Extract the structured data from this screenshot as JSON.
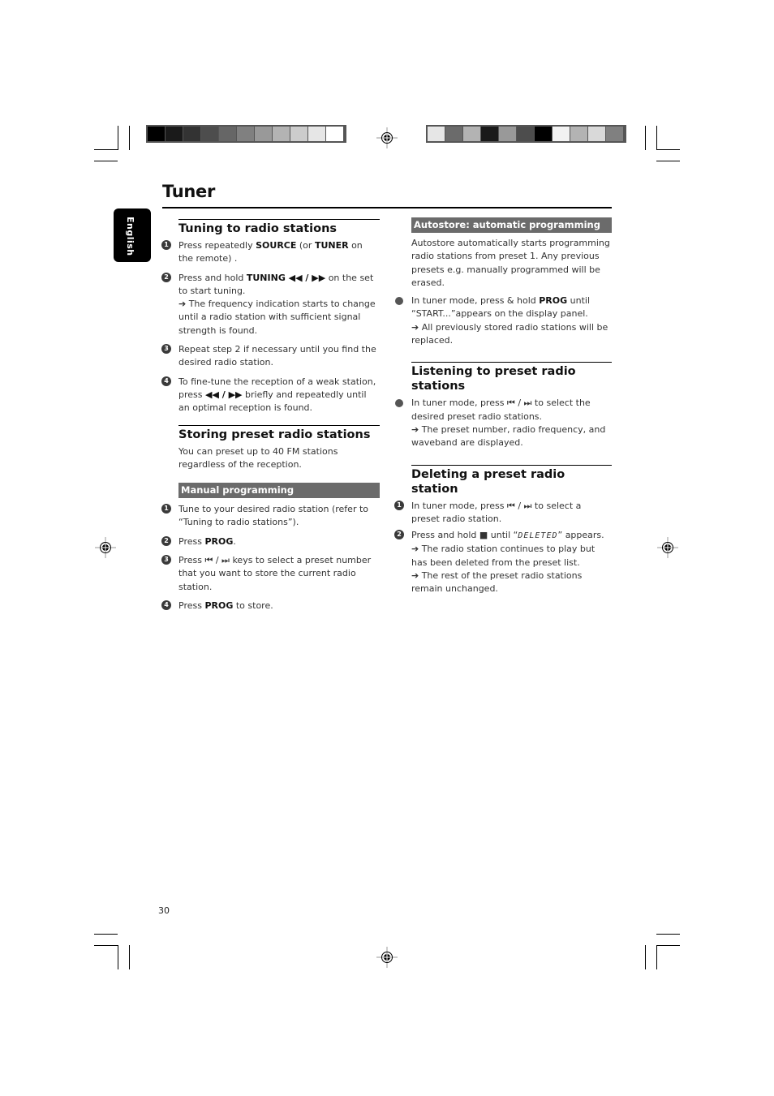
{
  "header": {
    "strip_left_colors": [
      "#000000",
      "#1a1a1a",
      "#333333",
      "#4d4d4d",
      "#666666",
      "#808080",
      "#999999",
      "#b3b3b3",
      "#cccccc",
      "#e6e6e6",
      "#ffffff"
    ],
    "strip_right_colors": [
      "#e6e6e6",
      "#6b6b6b",
      "#b3b3b3",
      "#1a1a1a",
      "#999999",
      "#4d4d4d",
      "#000000",
      "#f2f2f2",
      "#b3b3b3",
      "#d9d9d9",
      "#808080"
    ]
  },
  "page": {
    "title": "Tuner",
    "language_tab": "English",
    "page_number": "30"
  },
  "left": {
    "tuning": {
      "heading": "Tuning to radio stations",
      "steps": [
        {
          "num": "1",
          "parts": [
            [
              "t",
              "Press repeatedly "
            ],
            [
              "b",
              "SOURCE"
            ],
            [
              "t",
              " (or "
            ],
            [
              "b",
              "TUNER"
            ],
            [
              "t",
              " on the remote) ."
            ]
          ]
        },
        {
          "num": "2",
          "parts": [
            [
              "t",
              "Press and hold "
            ],
            [
              "b",
              "TUNING ◀◀ / ▶▶"
            ],
            [
              "t",
              " on the set to start tuning."
            ],
            [
              "br",
              ""
            ],
            [
              "t",
              "➔ The frequency indication starts to change until a radio station with sufficient signal strength is found."
            ]
          ]
        },
        {
          "num": "3",
          "parts": [
            [
              "t",
              "Repeat step 2 if necessary until you find the desired radio station."
            ]
          ]
        },
        {
          "num": "4",
          "parts": [
            [
              "t",
              "To fine-tune the reception of a weak station, press "
            ],
            [
              "b",
              "◀◀ / ▶▶"
            ],
            [
              "t",
              " briefly and repeatedly until an optimal reception is found."
            ]
          ]
        }
      ]
    },
    "storing": {
      "heading": "Storing preset radio stations",
      "intro": "You can preset up to 40 FM stations regardless of the reception.",
      "subheading": "Manual programming",
      "steps": [
        {
          "num": "1",
          "parts": [
            [
              "t",
              "Tune to your desired radio station (refer to “Tuning to radio stations”)."
            ]
          ]
        },
        {
          "num": "2",
          "parts": [
            [
              "t",
              "Press "
            ],
            [
              "b",
              "PROG"
            ],
            [
              "t",
              "."
            ]
          ]
        },
        {
          "num": "3",
          "parts": [
            [
              "t",
              "Press ⏮ / ⏭ keys to select a preset number that you want to store the current radio station."
            ]
          ]
        },
        {
          "num": "4",
          "parts": [
            [
              "t",
              "Press "
            ],
            [
              "b",
              "PROG"
            ],
            [
              "t",
              " to store."
            ]
          ]
        }
      ]
    }
  },
  "right": {
    "autostore": {
      "subheading": "Autostore: automatic programming",
      "intro": "Autostore automatically starts programming radio stations from preset 1. Any previous presets e.g. manually programmed will be erased.",
      "bullets": [
        {
          "parts": [
            [
              "t",
              "In tuner mode, press & hold "
            ],
            [
              "b",
              "PROG"
            ],
            [
              "t",
              " until “START...”appears on the display panel."
            ],
            [
              "br",
              ""
            ],
            [
              "t",
              "➔ All previously stored radio stations will be replaced."
            ]
          ]
        }
      ]
    },
    "listening": {
      "heading": "Listening to preset radio stations",
      "bullets": [
        {
          "parts": [
            [
              "t",
              "In tuner mode, press ⏮ / ⏭ to select the desired preset radio stations."
            ],
            [
              "br",
              ""
            ],
            [
              "t",
              "➔ The preset number, radio frequency, and waveband are displayed."
            ]
          ]
        }
      ]
    },
    "deleting": {
      "heading": "Deleting a preset radio station",
      "steps": [
        {
          "num": "1",
          "parts": [
            [
              "t",
              "In tuner mode, press ⏮ / ⏭ to select a preset radio station."
            ]
          ]
        },
        {
          "num": "2",
          "parts": [
            [
              "t",
              "Press and hold ■ until “"
            ],
            [
              "lcd",
              "DELETED"
            ],
            [
              "t",
              "” appears."
            ],
            [
              "br",
              ""
            ],
            [
              "t",
              "➔ The radio station continues to play but has been deleted from the preset list."
            ],
            [
              "br",
              ""
            ],
            [
              "t",
              "➔ The rest of the preset radio stations remain unchanged."
            ]
          ]
        }
      ]
    }
  }
}
